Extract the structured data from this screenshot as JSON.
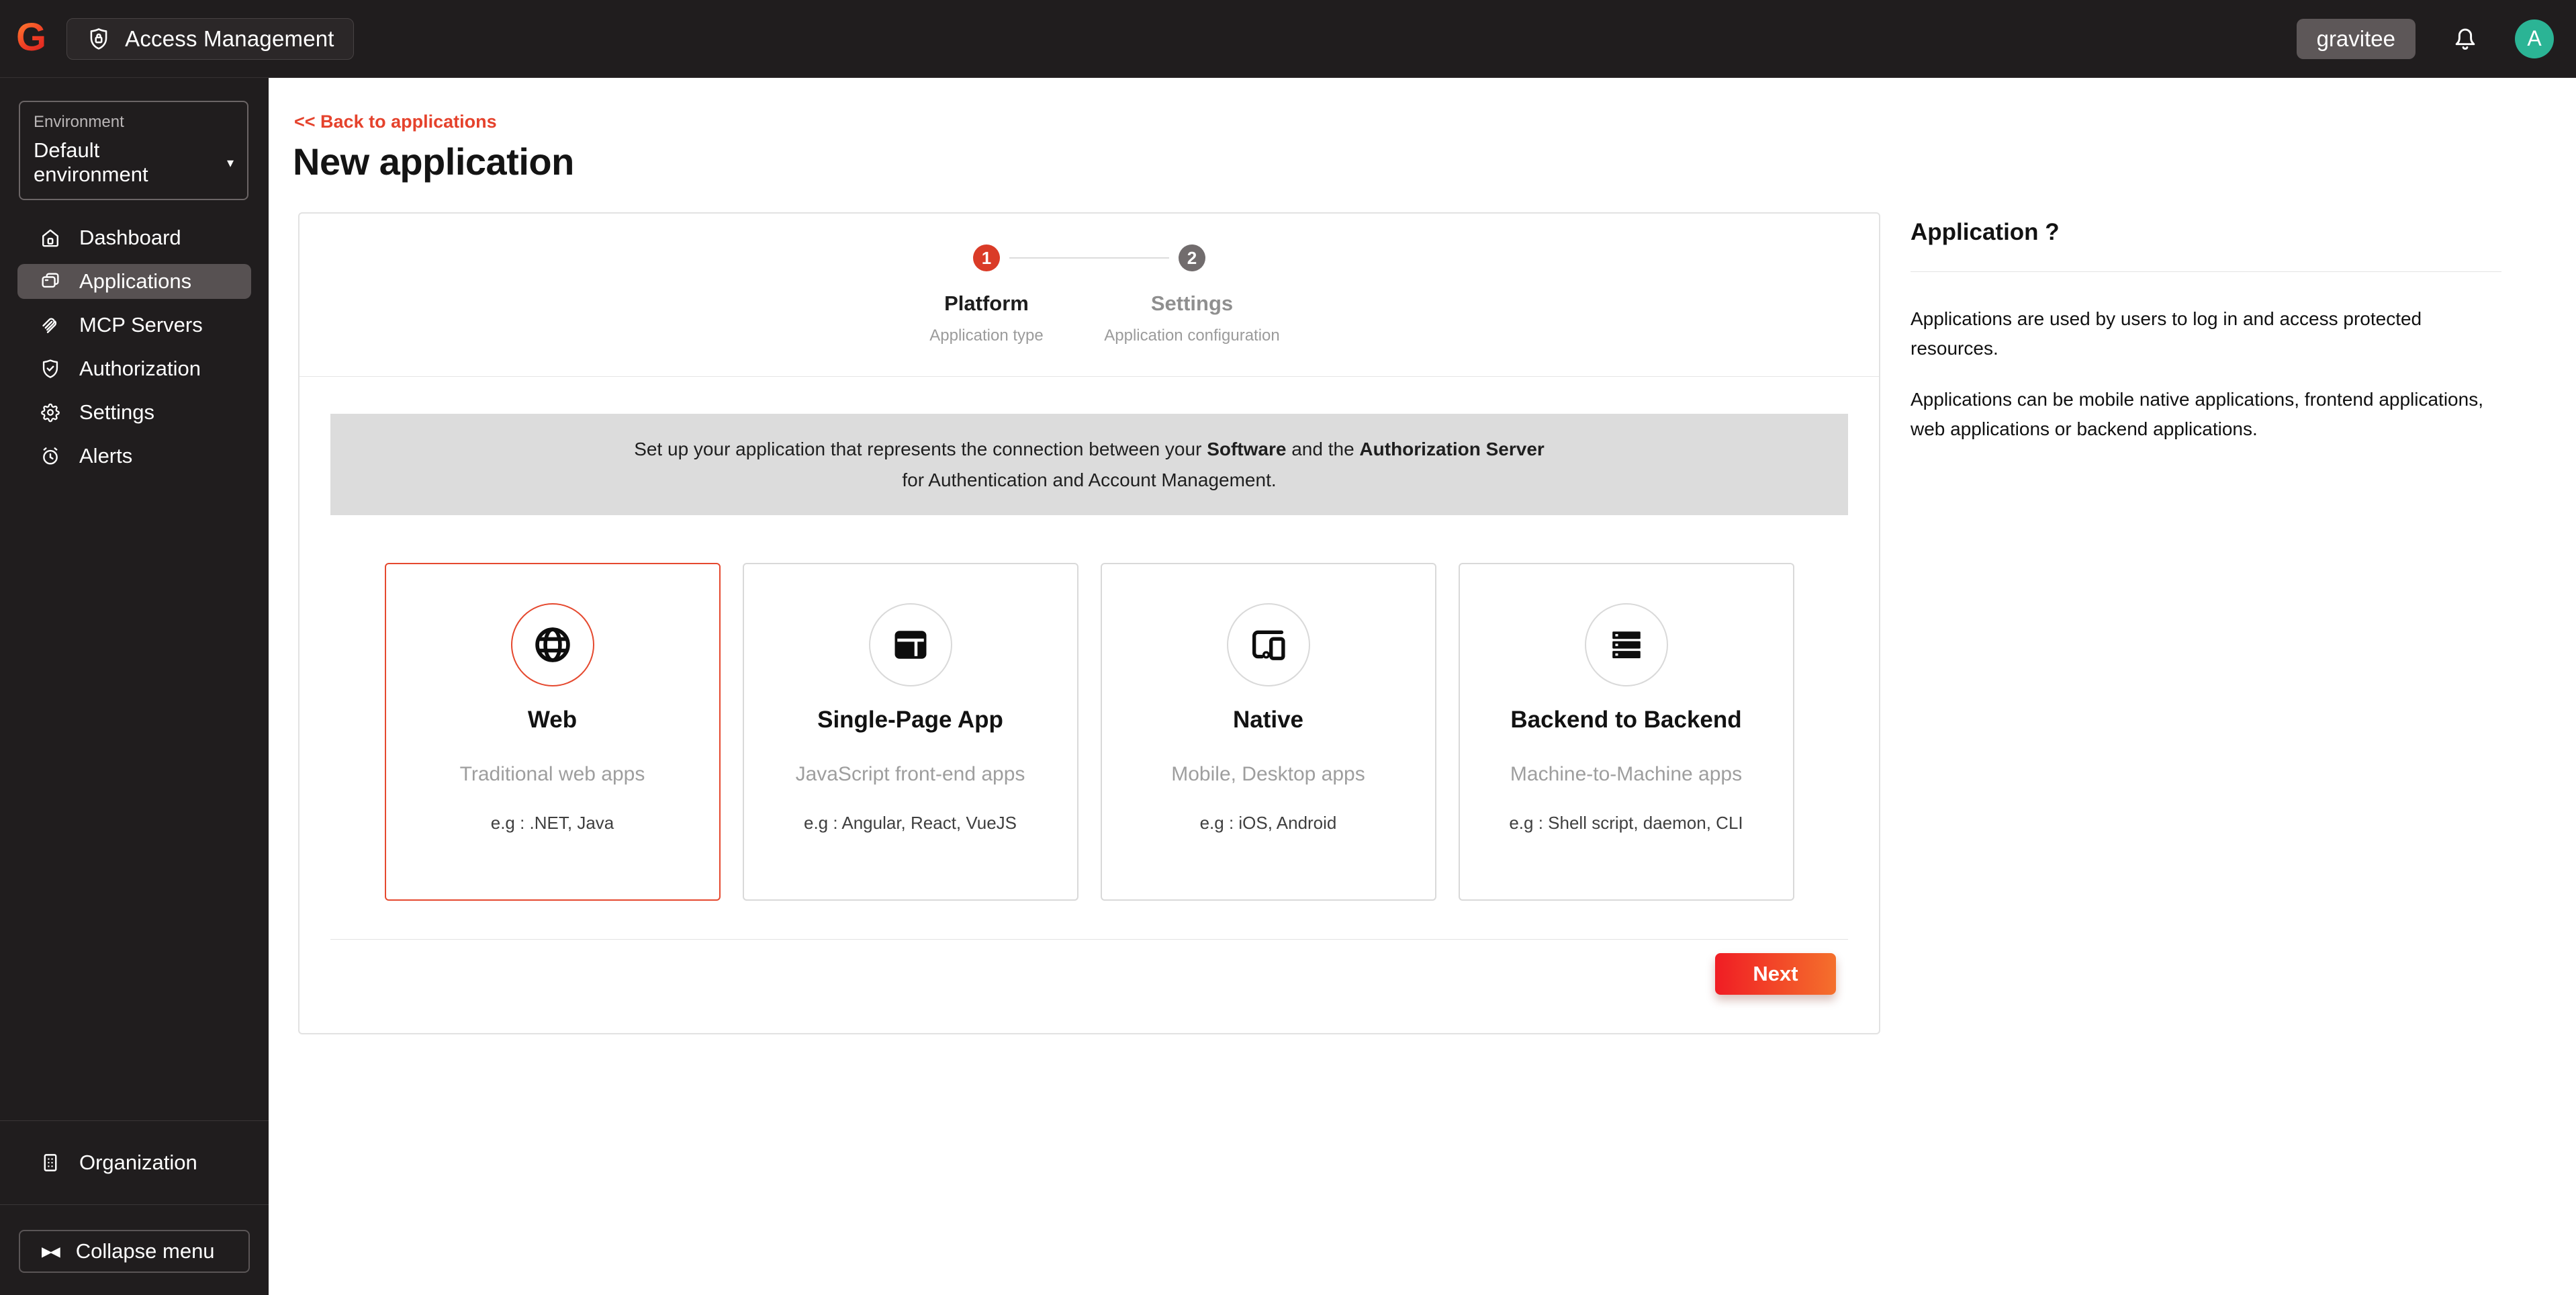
{
  "topbar": {
    "badge_label": "Access Management",
    "org_button_label": "gravitee",
    "avatar_initial": "A"
  },
  "sidebar": {
    "environment_label": "Environment",
    "environment_value": "Default environment",
    "items": [
      {
        "label": "Dashboard",
        "icon": "home-icon",
        "active": false
      },
      {
        "label": "Applications",
        "icon": "applications-icon",
        "active": true
      },
      {
        "label": "MCP Servers",
        "icon": "paperclip-icon",
        "active": false
      },
      {
        "label": "Authorization",
        "icon": "shield-check-icon",
        "active": false
      },
      {
        "label": "Settings",
        "icon": "gear-icon",
        "active": false
      },
      {
        "label": "Alerts",
        "icon": "alarm-clock-icon",
        "active": false
      }
    ],
    "organization_label": "Organization",
    "collapse_label": "Collapse menu"
  },
  "main": {
    "back_link": "<< Back to applications",
    "title": "New application",
    "stepper": [
      {
        "number": "1",
        "label": "Platform",
        "sublabel": "Application type",
        "active": true
      },
      {
        "number": "2",
        "label": "Settings",
        "sublabel": "Application configuration",
        "active": false
      }
    ],
    "info": {
      "pre": "Set up your application that represents the connection between your ",
      "bold1": "Software",
      "mid": " and the ",
      "bold2": "Authorization Server",
      "line2": "for Authentication and Account Management."
    },
    "cards": [
      {
        "title": "Web",
        "subtitle": "Traditional web apps",
        "example": "e.g : .NET, Java",
        "icon": "globe-icon",
        "selected": true
      },
      {
        "title": "Single-Page App",
        "subtitle": "JavaScript front-end apps",
        "example": "e.g : Angular, React, VueJS",
        "icon": "browser-window-icon",
        "selected": false
      },
      {
        "title": "Native",
        "subtitle": "Mobile, Desktop apps",
        "example": "e.g : iOS, Android",
        "icon": "devices-icon",
        "selected": false
      },
      {
        "title": "Backend to Backend",
        "subtitle": "Machine-to-Machine apps",
        "example": "e.g : Shell script, daemon, CLI",
        "icon": "server-stack-icon",
        "selected": false
      }
    ],
    "next_label": "Next"
  },
  "aside": {
    "title": "Application ?",
    "paragraphs": [
      "Applications are used by users to log in and access protected resources.",
      "Applications can be mobile native applications, frontend applications, web applications or backend applications."
    ]
  },
  "colors": {
    "accent_red": "#e5422c",
    "step_active": "#da3b27",
    "next_gradient_start": "#f01d24",
    "next_gradient_end": "#f4702c",
    "topbar_bg": "#201d1e",
    "sidebar_active_bg": "#575152",
    "avatar_teal": "#2bb495",
    "info_banner_bg": "#dcdcdc",
    "card_border": "#d9d9d9"
  }
}
